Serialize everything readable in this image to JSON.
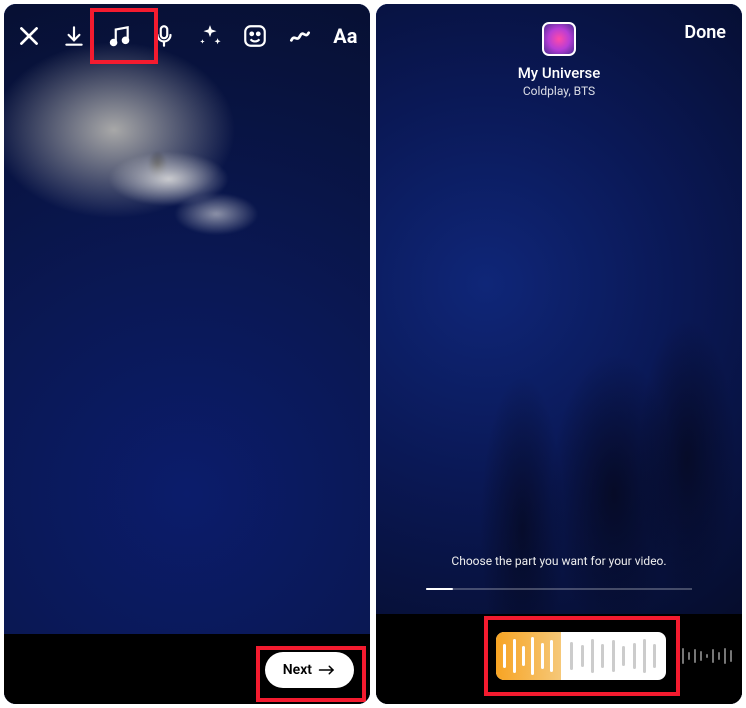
{
  "left": {
    "toolbar": {
      "close": "close-icon",
      "arrow_down": "download-icon",
      "music": "music-icon",
      "mic": "microphone-icon",
      "sparkle": "sparkle-icon",
      "sticker": "sticker-icon",
      "draw": "scribble-icon",
      "text": "Aa"
    },
    "next_label": "Next"
  },
  "right": {
    "done_label": "Done",
    "song_title": "My Universe",
    "song_artist": "Coldplay,  BTS",
    "instruction": "Choose the part you want for your video.",
    "scrubber_fill_percent": 38
  },
  "highlight_color": "#f41b2f"
}
